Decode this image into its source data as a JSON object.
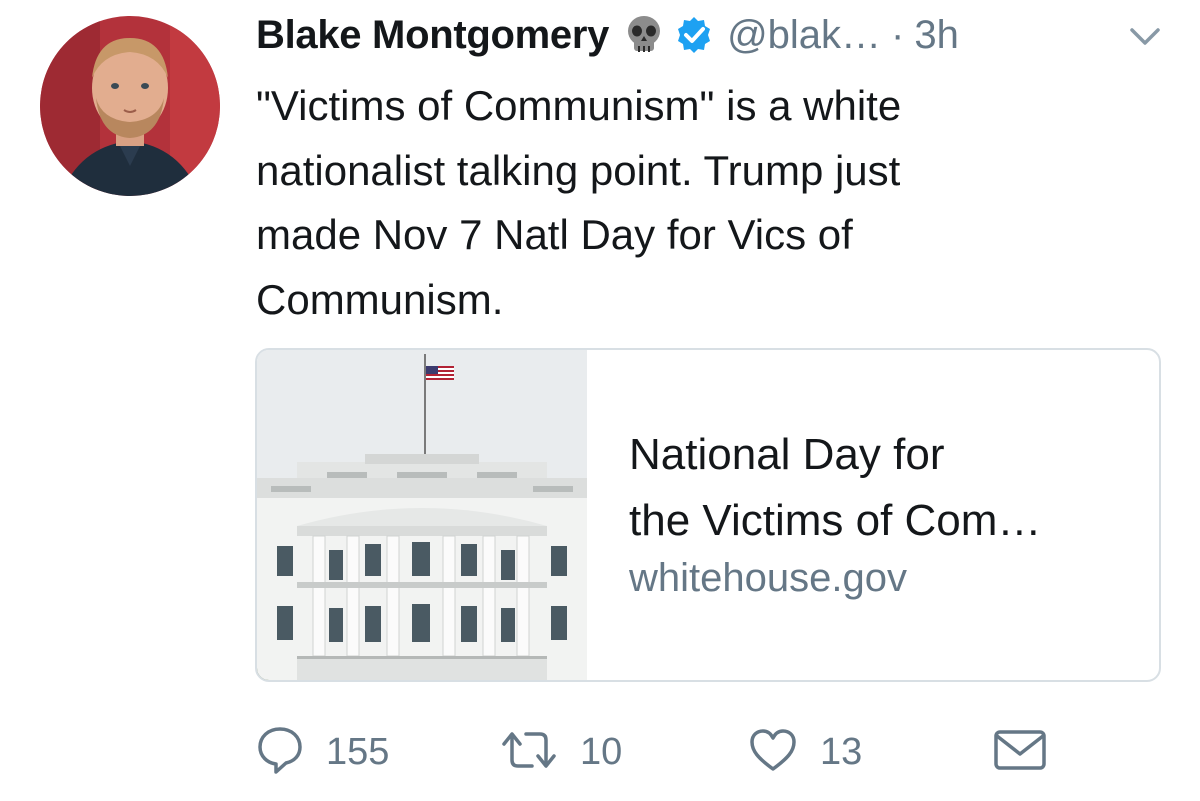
{
  "author": {
    "display_name": "Blake Montgomery",
    "emoji": "skull",
    "verified": true,
    "handle": "@blak…",
    "separator": "·",
    "time": "3h"
  },
  "tweet": {
    "lines": [
      "\"Victims of Communism\" is a white",
      "nationalist talking point. Trump just",
      "made Nov 7 Natl Day for Vics of",
      "Communism."
    ]
  },
  "card": {
    "title_lines": [
      "National Day for",
      "the Victims of Com…"
    ],
    "domain": "whitehouse.gov",
    "image": "white-house-photo"
  },
  "actions": {
    "reply_count": "155",
    "retweet_count": "10",
    "like_count": "13"
  },
  "colors": {
    "text": "#14171a",
    "secondary": "#657786",
    "verified_blue": "#1da1f2",
    "border": "#d8dfe4"
  },
  "icons": {
    "menu": "chevron-down-icon",
    "reply": "speech-bubble-icon",
    "retweet": "retweet-arrows-icon",
    "like": "heart-icon",
    "dm": "envelope-icon"
  }
}
